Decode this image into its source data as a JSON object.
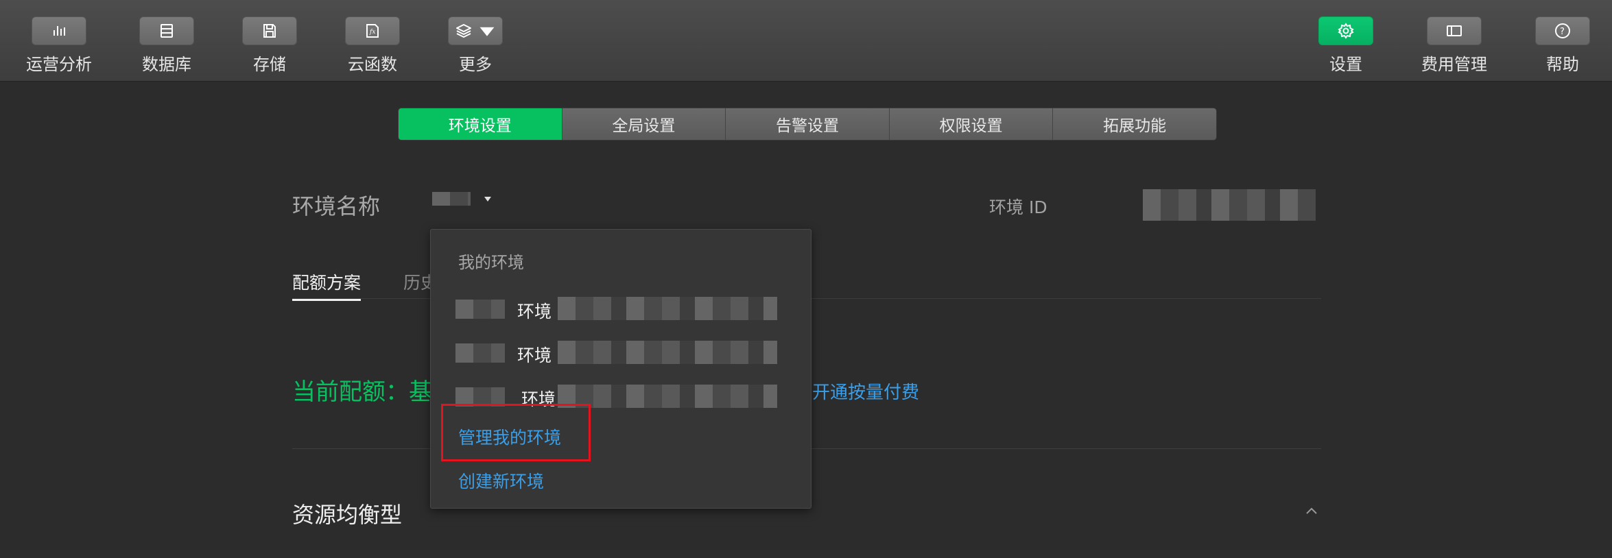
{
  "toolbar": {
    "left": [
      {
        "label": "运营分析",
        "icon": "bar-chart-icon"
      },
      {
        "label": "数据库",
        "icon": "database-icon"
      },
      {
        "label": "存储",
        "icon": "save-icon"
      },
      {
        "label": "云函数",
        "icon": "function-icon"
      },
      {
        "label": "更多",
        "icon": "layers-icon"
      }
    ],
    "right": [
      {
        "label": "设置",
        "icon": "gear-icon"
      },
      {
        "label": "费用管理",
        "icon": "billing-icon"
      },
      {
        "label": "帮助",
        "icon": "help-icon"
      }
    ]
  },
  "tabs": [
    "环境设置",
    "全局设置",
    "告警设置",
    "权限设置",
    "拓展功能"
  ],
  "env": {
    "name_label": "环境名称",
    "id_label": "环境 ID"
  },
  "subtabs": [
    "配额方案",
    "历史"
  ],
  "quota": {
    "text": "当前配额：基",
    "payg_link": "开通按量付费"
  },
  "section": {
    "title": "资源均衡型"
  },
  "dropdown": {
    "header": "我的环境",
    "items": [
      "环境",
      "环境",
      "环境"
    ],
    "manage": "管理我的环境",
    "create": "创建新环境"
  },
  "colors": {
    "accent": "#07c160",
    "link": "#3a9fe8",
    "highlight": "#e3141d"
  }
}
